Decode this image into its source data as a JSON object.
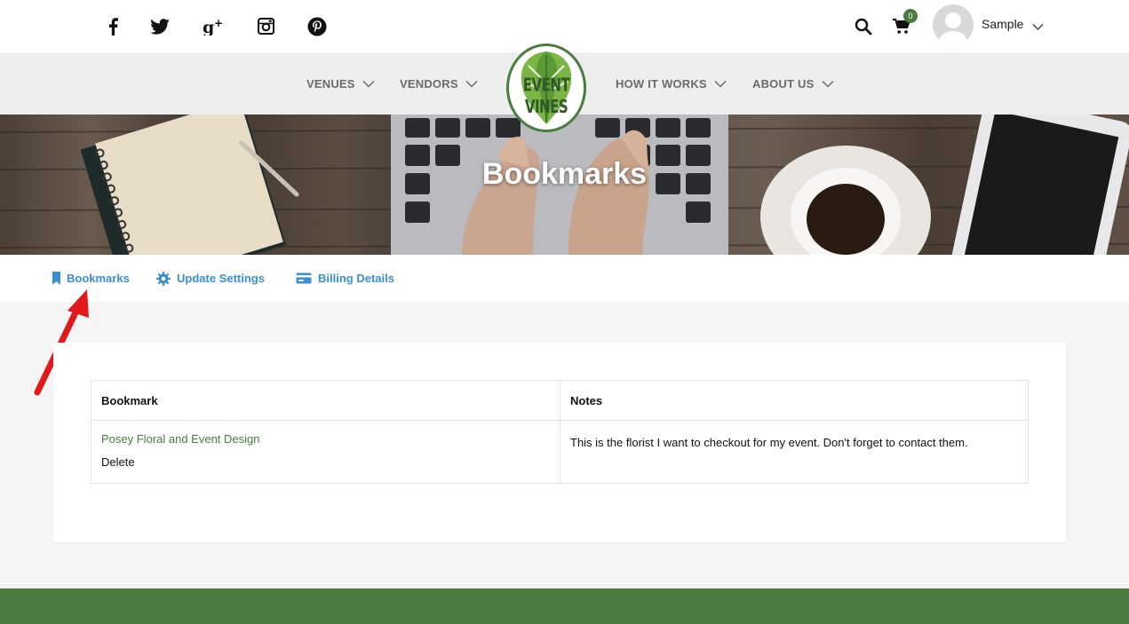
{
  "social": [
    "facebook-icon",
    "twitter-icon",
    "google-plus-icon",
    "instagram-icon",
    "pinterest-icon"
  ],
  "header": {
    "cart_count": "0",
    "username": "Sample"
  },
  "nav": {
    "venues": "VENUES",
    "vendors": "VENDORS",
    "logo_text": "EVENT VINES",
    "how_it_works": "HOW IT WORKS",
    "about_us": "ABOUT US"
  },
  "hero": {
    "title": "Bookmarks"
  },
  "tabs": {
    "bookmarks": "Bookmarks",
    "update_settings": "Update Settings",
    "billing_details": "Billing Details"
  },
  "table": {
    "headers": [
      "Bookmark",
      "Notes"
    ],
    "rows": [
      {
        "bookmark": "Posey Floral and Event Design",
        "delete": "Delete",
        "notes": "This is the florist I want to checkout for my event. Don't forget to contact them."
      }
    ]
  },
  "colors": {
    "brand_green": "#4a7c3f",
    "link_blue": "#3b8fd1",
    "annotation_red": "#e0191b"
  }
}
